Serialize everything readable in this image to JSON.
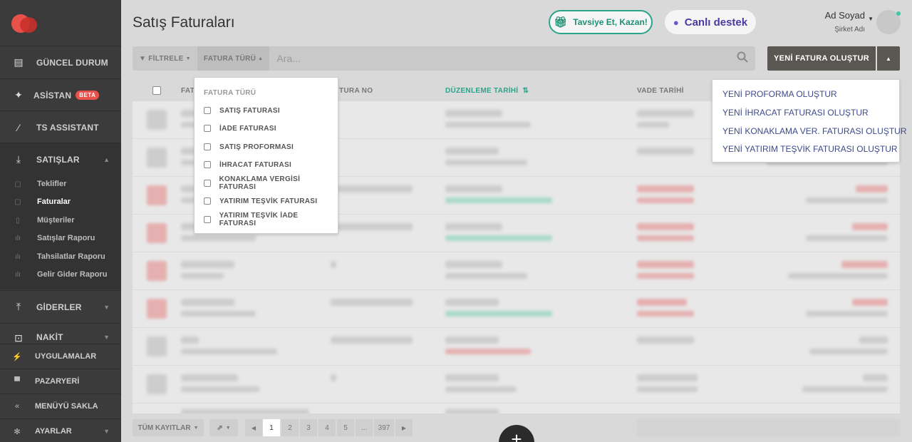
{
  "page": {
    "title": "Satış Faturaları"
  },
  "header": {
    "refer_label": "Tavsiye Et, Kazan!",
    "support_label": "Canlı destek",
    "user_name": "Ad Soyad",
    "company_name": "Şirket Adı"
  },
  "sidebar": {
    "items": [
      {
        "label": "GÜNCEL DURUM",
        "icon": "dashboard-icon"
      },
      {
        "label": "ASİSTAN",
        "badge": "BETA",
        "icon": "sparkle-icon"
      },
      {
        "label": "TS ASSISTANT",
        "icon": "magic-wand-icon"
      },
      {
        "label": "SATIŞLAR",
        "icon": "download-icon"
      },
      {
        "label": "GİDERLER",
        "icon": "upload-icon"
      },
      {
        "label": "NAKİT",
        "icon": "cash-icon"
      }
    ],
    "sub_items": [
      {
        "label": "Teklifler"
      },
      {
        "label": "Faturalar"
      },
      {
        "label": "Müşteriler"
      },
      {
        "label": "Satışlar Raporu"
      },
      {
        "label": "Tahsilatlar Raporu"
      },
      {
        "label": "Gelir Gider Raporu"
      }
    ],
    "bottom": [
      {
        "label": "UYGULAMALAR",
        "icon": "plug-icon"
      },
      {
        "label": "PAZARYERİ",
        "icon": "cart-icon"
      },
      {
        "label": "MENÜYÜ SAKLA",
        "icon": "collapse-icon"
      },
      {
        "label": "AYARLAR",
        "icon": "settings-icon"
      }
    ]
  },
  "toolbar": {
    "filter_label": "FİLTRELE",
    "invoice_type_label": "FATURA TÜRÜ",
    "search_placeholder": "Ara...",
    "new_invoice_label": "YENİ FATURA OLUŞTUR"
  },
  "table": {
    "columns": [
      "FAT",
      "TURA NO",
      "DÜZENLEME TARİHİ",
      "VADE TARİHİ"
    ]
  },
  "invoice_type_menu": {
    "header": "FATURA TÜRÜ",
    "options": [
      "SATIŞ FATURASI",
      "İADE FATURASI",
      "SATIŞ PROFORMASI",
      "İHRACAT FATURASI",
      "KONAKLAMA VERGİSİ FATURASI",
      "YATIRIM TEŞVİK FATURASI",
      "YATIRIM TEŞVİK İADE FATURASI"
    ]
  },
  "new_menu": {
    "items": [
      "YENİ PROFORMA OLUŞTUR",
      "YENİ İHRACAT FATURASI OLUŞTUR",
      "YENİ KONAKLAMA VER. FATURASI OLUŞTUR",
      "YENİ YATIRIM TEŞVİK FATURASI OLUŞTUR"
    ]
  },
  "footer": {
    "all_records_label": "TÜM KAYITLAR",
    "pages": [
      "1",
      "2",
      "3",
      "4",
      "5",
      "...",
      "397"
    ],
    "current_page": "1"
  },
  "colors": {
    "accent": "#2aa58a",
    "brand": "#e8524a",
    "sidebar": "#3b3b3b",
    "primary_button": "#5a5652"
  }
}
